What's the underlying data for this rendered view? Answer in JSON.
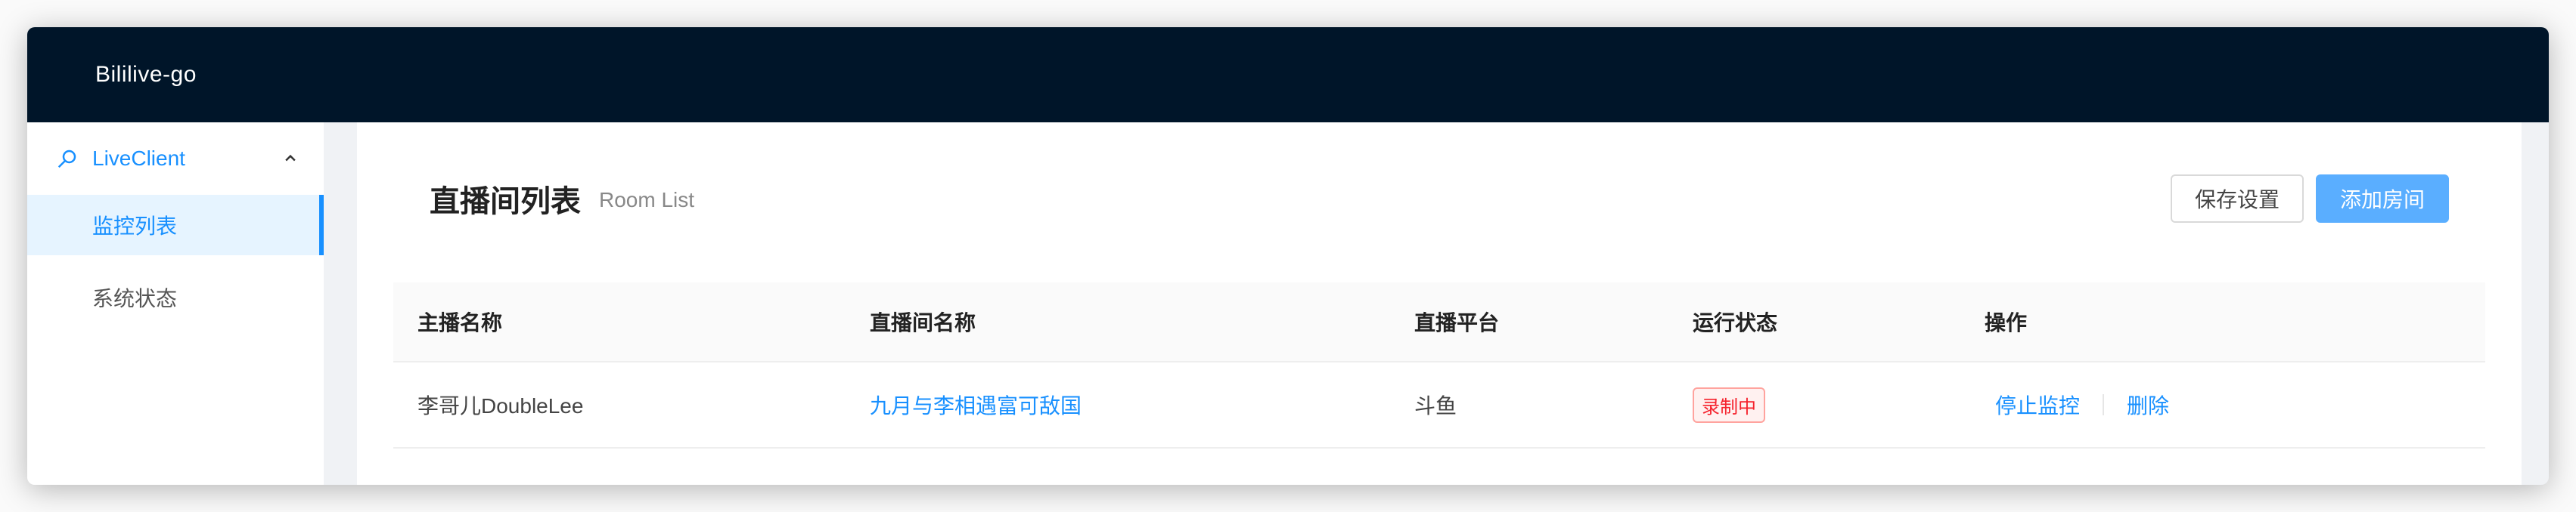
{
  "app": {
    "title": "Bililive-go"
  },
  "sidebar": {
    "group": {
      "label": "LiveClient",
      "icon": "search-icon",
      "expanded": true
    },
    "items": [
      {
        "label": "监控列表",
        "active": true
      },
      {
        "label": "系统状态",
        "active": false
      }
    ]
  },
  "page": {
    "title": "直播间列表",
    "subtitle": "Room List",
    "buttons": {
      "save": "保存设置",
      "add": "添加房间"
    }
  },
  "table": {
    "columns": [
      "主播名称",
      "直播间名称",
      "直播平台",
      "运行状态",
      "操作"
    ],
    "rows": [
      {
        "host": "李哥儿DoubleLee",
        "room": "九月与李相遇富可敌国",
        "platform": "斗鱼",
        "status": "录制中",
        "actions": [
          "停止监控",
          "删除"
        ]
      }
    ]
  },
  "colors": {
    "header": "#001529",
    "accent": "#1890ff",
    "status_recording": "#f5222d"
  }
}
